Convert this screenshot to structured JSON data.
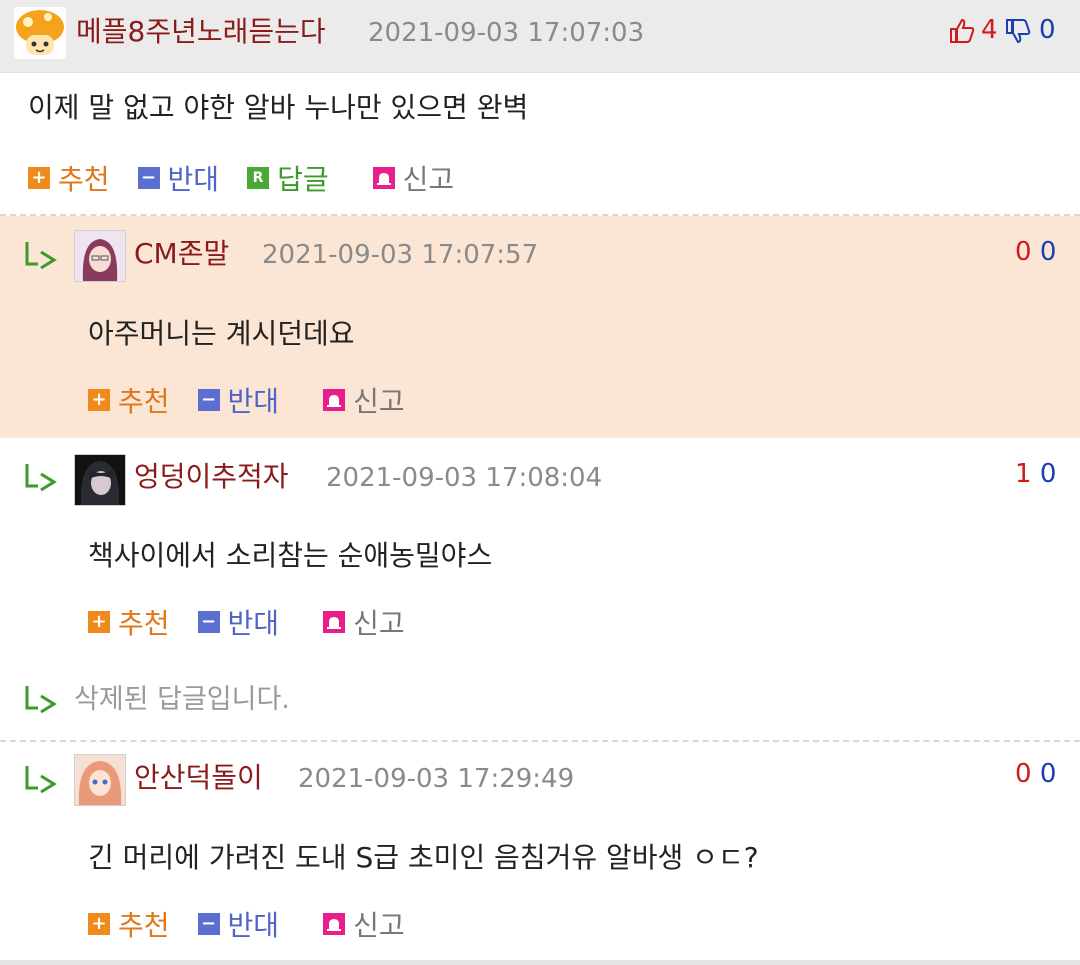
{
  "main_comment": {
    "nickname": "메플8주년노래듣는다",
    "date": "2021-09-03 17:07:03",
    "up_count": "4",
    "down_count": "0",
    "text": "이제 말 없고 야한 알바 누나만 있으면 완벽",
    "actions": {
      "recommend": "추천",
      "oppose": "반대",
      "reply": "답글",
      "report": "신고",
      "reply_badge": "R"
    }
  },
  "replies": [
    {
      "nickname": "CM존말",
      "date": "2021-09-03 17:07:57",
      "up": "0",
      "down": "0",
      "text": "아주머니는 계시던데요",
      "highlight_color": "#fbe6d6"
    },
    {
      "nickname": "엉덩이추적자",
      "date": "2021-09-03 17:08:04",
      "up": "1",
      "down": "0",
      "text": "책사이에서 소리참는 순애농밀야스"
    },
    {
      "deleted_text": "삭제된 답글입니다."
    },
    {
      "nickname": "안산덕돌이",
      "date": "2021-09-03 17:29:49",
      "up": "0",
      "down": "0",
      "text": "긴 머리에 가려진 도내 S급 초미인 음침거유 알바생 ㅇㄷ?"
    }
  ],
  "reply_actions": {
    "recommend": "추천",
    "oppose": "반대",
    "report": "신고"
  },
  "colors": {
    "nickname": "#8b1a1a",
    "up": "#d11a1a",
    "down": "#1b3fb0",
    "highlight": "#fbe6d6"
  },
  "icons": {
    "main_avatar": "mushroom-avatar-icon",
    "thumbs_up": "thumbs-up-icon",
    "thumbs_down": "thumbs-down-icon",
    "reply_arrow": "reply-arrow-icon",
    "plus": "plus-icon",
    "minus": "minus-icon",
    "siren": "siren-icon"
  }
}
